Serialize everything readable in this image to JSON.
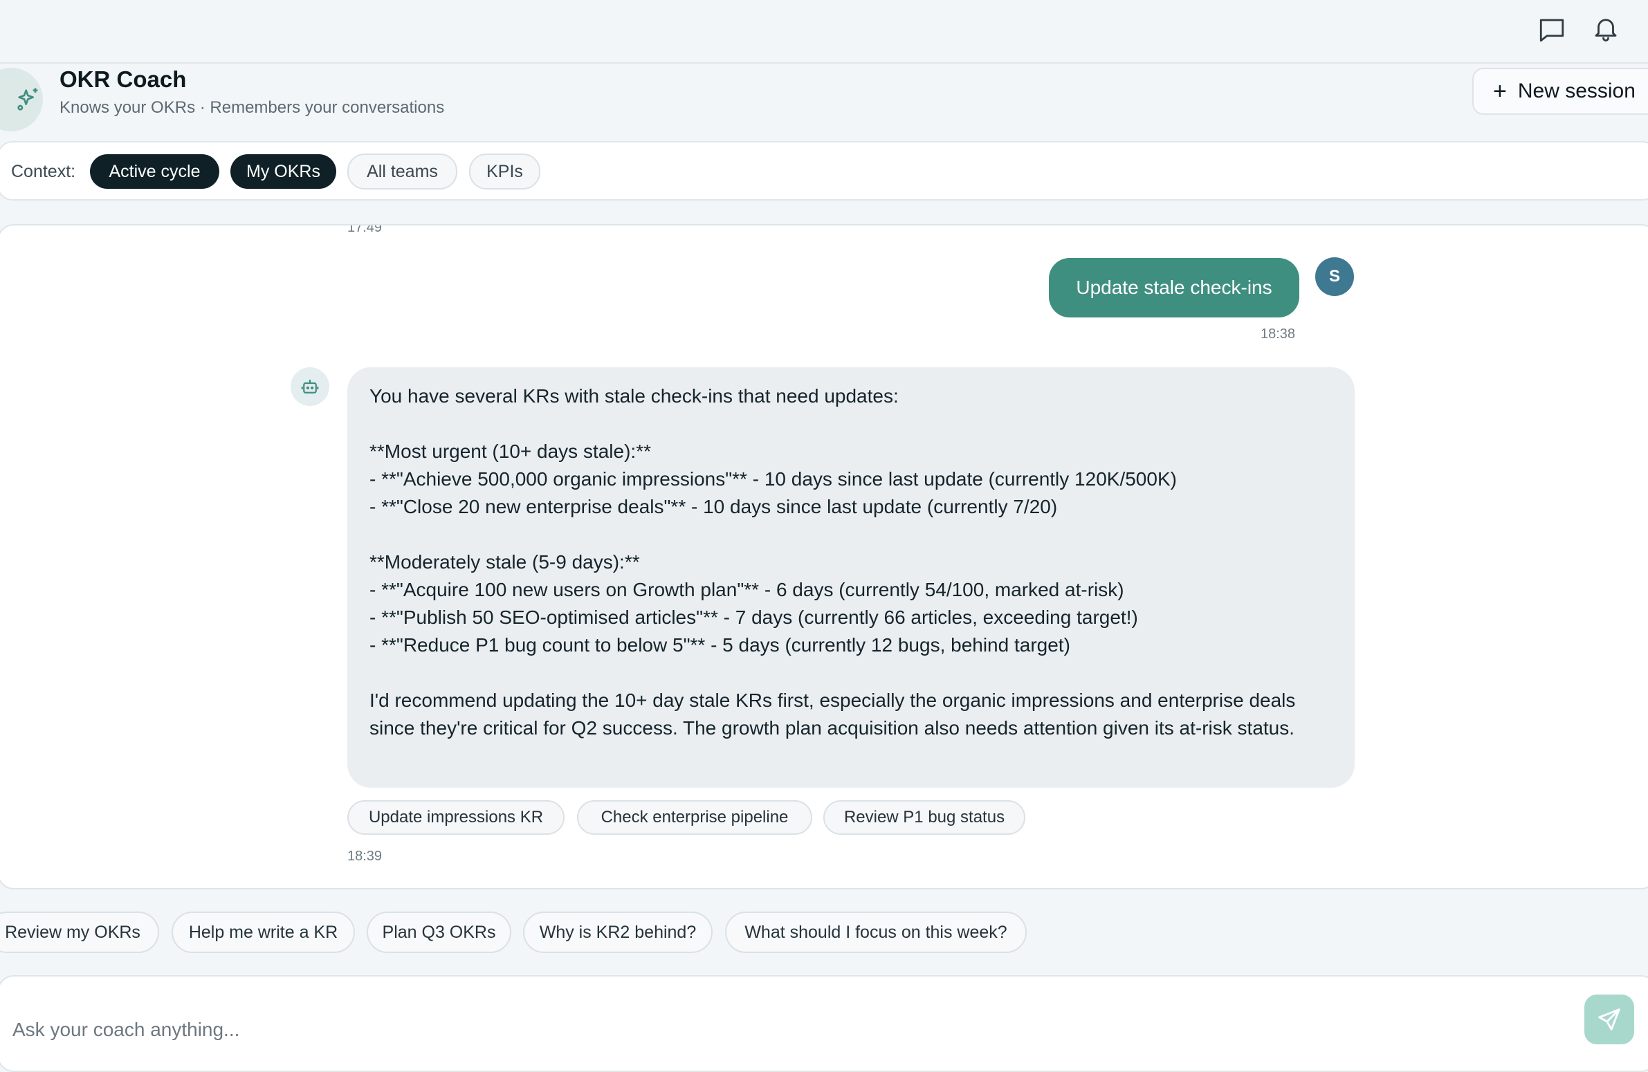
{
  "header": {
    "title": "OKR Coach",
    "subtitle": "Knows your OKRs · Remembers your conversations",
    "new_session_label": "New session"
  },
  "context": {
    "label": "Context:",
    "chips": [
      {
        "label": "Active cycle",
        "active": true
      },
      {
        "label": "My OKRs",
        "active": true
      },
      {
        "label": "All teams",
        "active": false
      },
      {
        "label": "KPIs",
        "active": false
      }
    ]
  },
  "messages": {
    "previous_timestamp": "17:49",
    "user": {
      "avatar_initial": "S",
      "text": "Update stale check-ins",
      "timestamp": "18:38"
    },
    "assistant": {
      "lines": [
        "You have several KRs with stale check-ins that need updates:",
        "",
        "**Most urgent (10+ days stale):**",
        "- **\"Achieve 500,000 organic impressions\"** - 10 days since last update (currently 120K/500K)",
        "- **\"Close 20 new enterprise deals\"** - 10 days since last update (currently 7/20)",
        "",
        "**Moderately stale (5-9 days):**",
        "- **\"Acquire 100 new users on Growth plan\"** - 6 days (currently 54/100, marked at-risk)",
        "- **\"Publish 50 SEO-optimised articles\"** - 7 days (currently 66 articles, exceeding target!)",
        "- **\"Reduce P1 bug count to below 5\"** - 5 days (currently 12 bugs, behind target)",
        ""
      ],
      "closing": "I'd recommend updating the 10+ day stale KRs first, especially the organic impressions and enterprise deals since they're critical for Q2 success. The growth plan acquisition also needs attention given its at-risk status.",
      "quick_replies": [
        "Update impressions KR",
        "Check enterprise pipeline",
        "Review P1 bug status"
      ],
      "timestamp": "18:39"
    }
  },
  "suggestions": [
    "Review my OKRs",
    "Help me write a KR",
    "Plan Q3 OKRs",
    "Why is KR2 behind?",
    "What should I focus on this week?"
  ],
  "composer": {
    "placeholder": "Ask your coach anything..."
  },
  "colors": {
    "accent": "#3f8f81",
    "chip_active_bg": "#0f2027",
    "send_button_bg": "#a8d8cc",
    "user_avatar_bg": "#3e7891"
  },
  "icons": {
    "top_right": [
      "chat-bubble-icon",
      "bell-icon"
    ],
    "coach": "sparkles-icon",
    "bot": "robot-icon",
    "send": "send-icon"
  }
}
